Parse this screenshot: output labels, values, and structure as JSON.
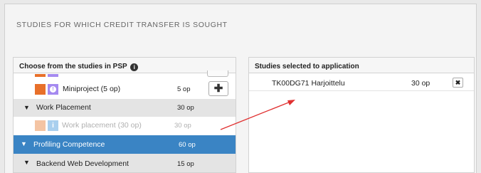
{
  "section": {
    "title": "STUDIES FOR WHICH CREDIT TRANSFER IS SOUGHT"
  },
  "left_panel": {
    "header": "Choose from the studies in PSP",
    "info_icon": "i",
    "rows": {
      "miniproject": {
        "label": "Miniproject (5 op)",
        "op": "5 op",
        "badge": "!",
        "add_icon": "✚"
      },
      "work_placement": {
        "label": "Work Placement",
        "op": "30 op",
        "chevron": "▼"
      },
      "work_placement_course": {
        "label": "Work placement (30 op)",
        "op": "30 op",
        "badge": "i"
      },
      "profiling_competence": {
        "label": "Profiling Competence",
        "op": "60 op",
        "chevron": "▼"
      },
      "backend_web": {
        "label": "Backend Web Development",
        "op": "15 op",
        "chevron": "▼"
      }
    }
  },
  "right_panel": {
    "header": "Studies selected to application",
    "selected": {
      "code_name": "TK00DG71 Harjoittelu",
      "op": "30 op",
      "remove_icon": "✖"
    }
  },
  "colors": {
    "primary_blue": "#3a84c4",
    "orange": "#e8702a",
    "purple": "#a58af0",
    "annotation_arrow": "#e03030"
  }
}
